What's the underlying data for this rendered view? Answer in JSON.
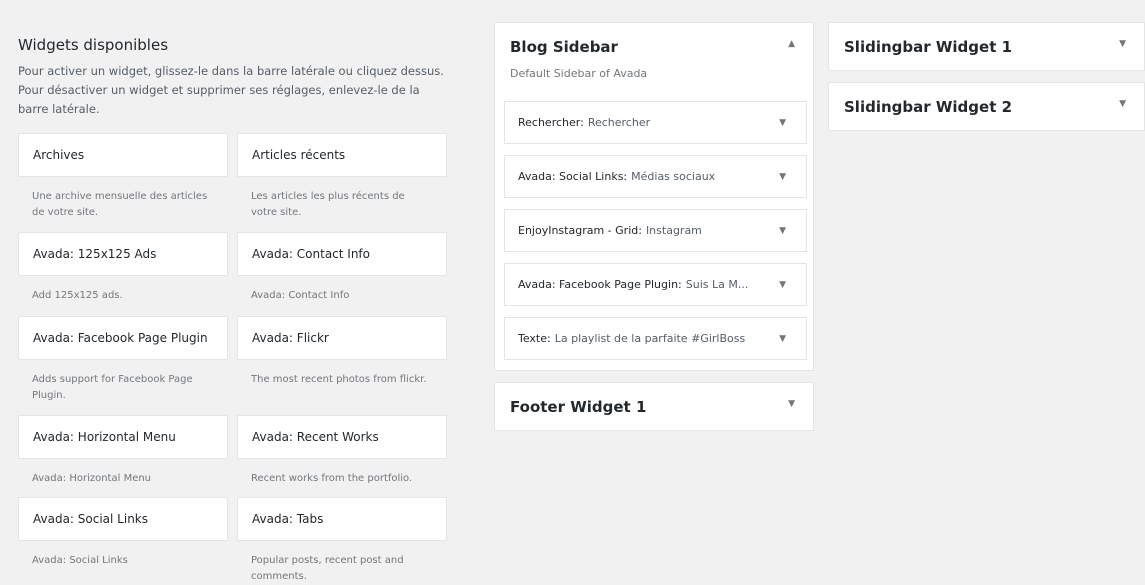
{
  "available": {
    "title": "Widgets disponibles",
    "description": "Pour activer un widget, glissez-le dans la barre latérale ou cliquez dessus. Pour désactiver un widget et supprimer ses réglages, enlevez-le de la barre latérale."
  },
  "widgets": [
    {
      "title": "Archives",
      "description": "Une archive mensuelle des articles de votre site."
    },
    {
      "title": "Articles récents",
      "description": "Les articles les plus récents de votre site."
    },
    {
      "title": "Avada: 125x125 Ads",
      "description": "Add 125x125 ads."
    },
    {
      "title": "Avada: Contact Info",
      "description": "Avada: Contact Info"
    },
    {
      "title": "Avada: Facebook Page Plugin",
      "description": "Adds support for Facebook Page Plugin."
    },
    {
      "title": "Avada: Flickr",
      "description": "The most recent photos from flickr."
    },
    {
      "title": "Avada: Horizontal Menu",
      "description": "Avada: Horizontal Menu"
    },
    {
      "title": "Avada: Recent Works",
      "description": "Recent works from the portfolio."
    },
    {
      "title": "Avada: Social Links",
      "description": "Avada: Social Links"
    },
    {
      "title": "Avada: Tabs",
      "description": "Popular posts, recent post and comments."
    }
  ],
  "blog_sidebar": {
    "title": "Blog Sidebar",
    "description": "Default Sidebar of Avada",
    "arrow_icon": "▲",
    "widgets": [
      {
        "name": "Rechercher:",
        "subtitle": "Rechercher"
      },
      {
        "name": "Avada: Social Links:",
        "subtitle": "Médias sociaux"
      },
      {
        "name": "EnjoyInstagram - Grid:",
        "subtitle": "Instagram"
      },
      {
        "name": "Avada: Facebook Page Plugin:",
        "subtitle": "Suis La M..."
      },
      {
        "name": "Texte:",
        "subtitle": "La playlist de la parfaite #GirlBoss"
      }
    ]
  },
  "footer_widget_1": {
    "title": "Footer Widget 1"
  },
  "slidingbar_widget_1": {
    "title": "Slidingbar Widget 1"
  },
  "slidingbar_widget_2": {
    "title": "Slidingbar Widget 2"
  },
  "icons": {
    "down_arrow": "▼"
  }
}
